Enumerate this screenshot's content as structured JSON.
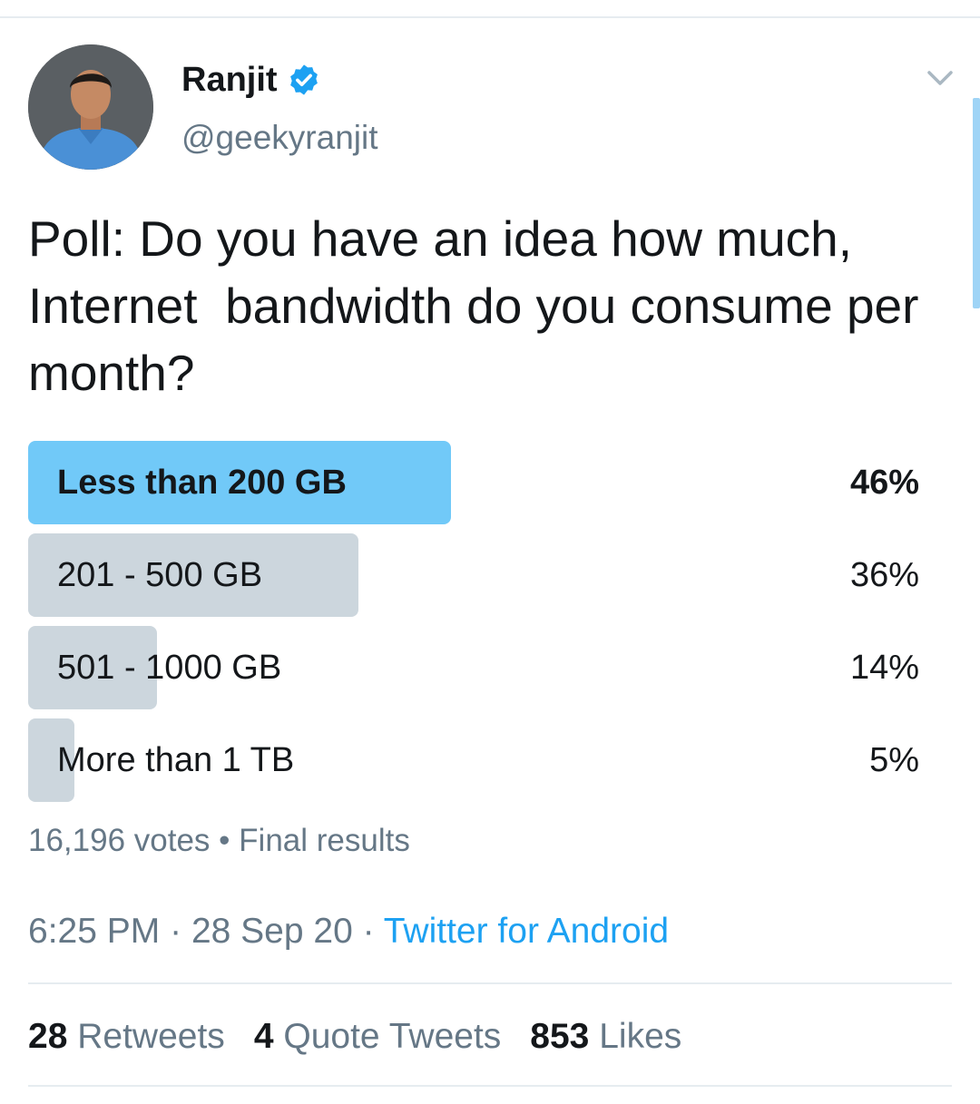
{
  "tweet": {
    "author": {
      "display_name": "Ranjit",
      "handle": "@geekyranjit",
      "verified_icon": "verified-badge-icon",
      "avatar_icon": "person-avatar"
    },
    "text": "Poll: Do you have an idea how much,\nInternet  bandwidth do you consume per month?",
    "poll": {
      "options": [
        {
          "label": "Less than 200 GB",
          "percent_label": "46%",
          "percent": 46,
          "winner": true
        },
        {
          "label": "201 - 500 GB",
          "percent_label": "36%",
          "percent": 36,
          "winner": false
        },
        {
          "label": "501 - 1000 GB",
          "percent_label": "14%",
          "percent": 14,
          "winner": false
        },
        {
          "label": "More than 1 TB",
          "percent_label": "5%",
          "percent": 5,
          "winner": false
        }
      ],
      "votes": "16,196 votes",
      "separator": "•",
      "status": "Final results"
    },
    "time": "6:25 PM",
    "date": "28 Sep 20",
    "source": "Twitter for Android",
    "dot": "·",
    "stats": {
      "retweets_count": "28",
      "retweets_label": "Retweets",
      "quotes_count": "4",
      "quotes_label": "Quote Tweets",
      "likes_count": "853",
      "likes_label": "Likes"
    }
  },
  "colors": {
    "accent": "#1da1f2",
    "winner_bar": "#71c9f8",
    "loser_bar": "#ccd6dd",
    "secondary_text": "#657786"
  }
}
